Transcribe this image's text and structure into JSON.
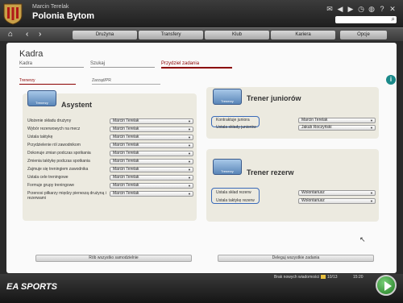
{
  "header": {
    "manager_name": "Marcin Terelak",
    "club_name": "Polonia Bytom",
    "icons": [
      "mail-icon",
      "back-icon",
      "forward-icon",
      "clock-icon",
      "globe-icon",
      "help-icon",
      "close-icon"
    ],
    "search_placeholder": ""
  },
  "nav": {
    "tabs": [
      "Drużyna",
      "Transfery",
      "Klub",
      "Kariera"
    ],
    "options_label": "Opcje"
  },
  "page": {
    "title": "Kadra",
    "tabs": [
      "Kadra",
      "Szukaj",
      "Przydziel zadania"
    ],
    "active_tab": "Przydziel zadania",
    "sub_tabs": [
      "Trenerzy",
      "Zarząd/PR"
    ],
    "active_sub_tab": "Trenerzy"
  },
  "assistant": {
    "title": "Asystent",
    "icon_label": "Trenerzy",
    "rows": [
      {
        "label": "Ułożenie składu drużyny",
        "value": "Marcin Terelak"
      },
      {
        "label": "Wybór rezerwowych na mecz",
        "value": "Marcin Terelak"
      },
      {
        "label": "Ustala taktykę",
        "value": "Marcin Terelak"
      },
      {
        "label": "Przydzielenie ról zawodnikom",
        "value": "Marcin Terelak"
      },
      {
        "label": "Dokonuje zmian podczas spotkania",
        "value": "Marcin Terelak"
      },
      {
        "label": "Zmienia taktykę podczas spotkania",
        "value": "Marcin Terelak"
      },
      {
        "label": "Zajmuje się treningiem zawodnika",
        "value": "Marcin Terelak"
      },
      {
        "label": "Ustala cele treningowe",
        "value": "Marcin Terelak"
      },
      {
        "label": "Formuje grupy treningowe",
        "value": "Marcin Terelak"
      },
      {
        "label": "Przenosi piłkarzy między pierwszą drużyną i rezerwami",
        "value": "Marcin Terelak"
      }
    ]
  },
  "youth": {
    "title": "Trener juniorów",
    "icon_label": "Trenerzy",
    "rows": [
      {
        "label": "Kontraktuje juniora",
        "value": "Marcin Terelak"
      },
      {
        "label": "Ustala składy juniorów",
        "value": "Jakub Roczyński"
      }
    ]
  },
  "reserve": {
    "title": "Trener rezerw",
    "icon_label": "Trenerzy",
    "rows": [
      {
        "label": "Ustala skład rezerw",
        "value": "Wolontariusz"
      },
      {
        "label": "Ustala taktykę rezerw",
        "value": "Wolontariusz"
      }
    ]
  },
  "bottom": {
    "self_label": "Rób wszystko samodzielnie",
    "delegate_label": "Deleguj wszystkie zadania"
  },
  "footer": {
    "logo": "EA SPORTS",
    "messages": "Brak nowych wiadomości",
    "date": "10/13",
    "time": "15:20"
  },
  "colors": {
    "accent": "#8b0000",
    "panel": "#eceae0",
    "continue": "#2e8b2e"
  }
}
